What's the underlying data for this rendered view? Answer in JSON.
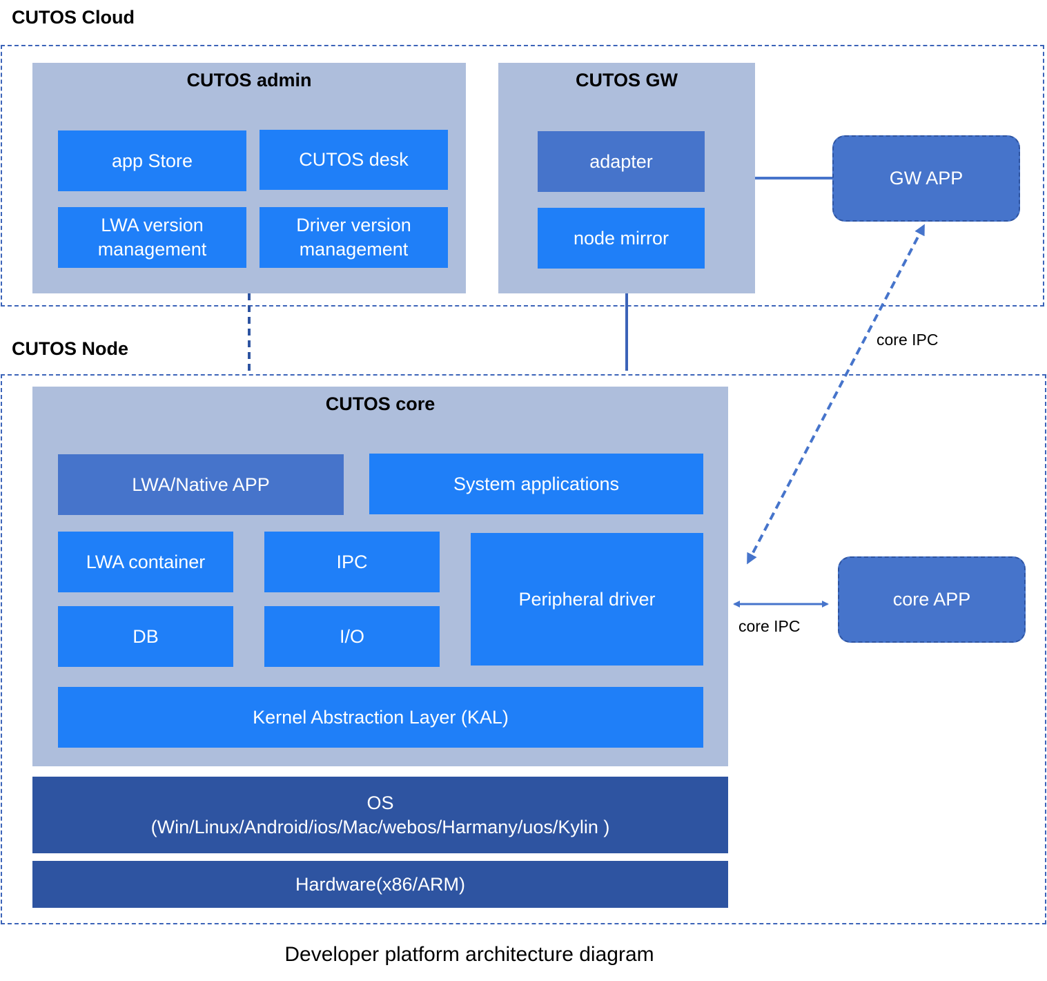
{
  "cloud": {
    "label": "CUTOS Cloud",
    "admin": {
      "title": "CUTOS admin",
      "items": [
        "app Store",
        "CUTOS desk",
        "LWA version management",
        "Driver version management"
      ]
    },
    "gw": {
      "title": "CUTOS GW",
      "items": [
        "adapter",
        "node mirror"
      ]
    },
    "gw_app": "GW APP"
  },
  "node": {
    "label": "CUTOS Node",
    "core": {
      "title": "CUTOS core",
      "lwa_native_app": "LWA/Native APP",
      "system_applications": "System applications",
      "lwa_container": "LWA container",
      "ipc": "IPC",
      "peripheral_driver": "Peripheral driver",
      "db": "DB",
      "io": "I/O",
      "kal": "Kernel Abstraction Layer (KAL)"
    },
    "os_line1": "OS",
    "os_line2": "(Win/Linux/Android/ios/Mac/webos/Harmany/uos/Kylin )",
    "hardware": "Hardware(x86/ARM)",
    "core_app": "core APP"
  },
  "connections": {
    "gw_to_core_label": "core IPC",
    "core_to_app_label": "core IPC"
  },
  "caption": "Developer platform architecture diagram",
  "colors": {
    "group": "#AEBEDC",
    "bright_blue": "#1F7FF8",
    "medium_blue": "#4674CB",
    "dark_blue": "#2E54A1",
    "dashed_border": "#3B63B8"
  }
}
